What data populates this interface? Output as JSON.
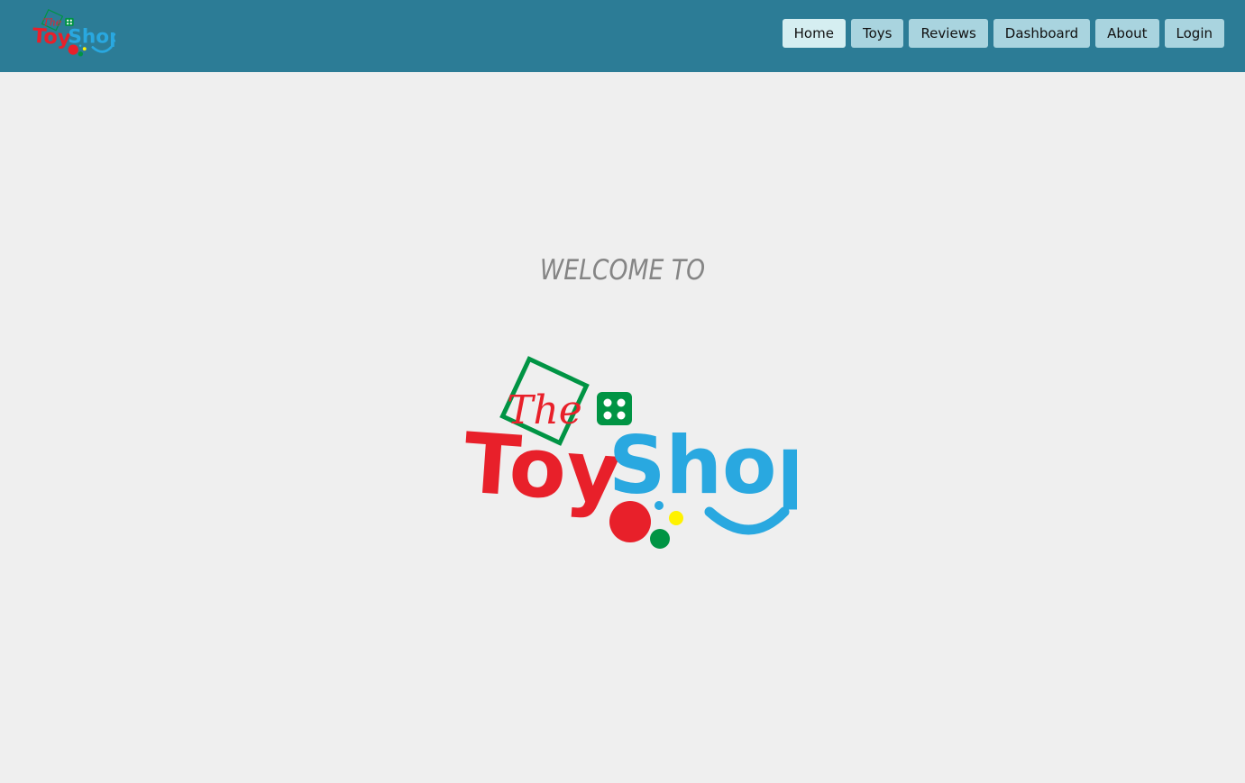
{
  "navbar": {
    "logo": {
      "icon": "toy-shop-logo-icon",
      "text_the": "The",
      "text_toy": "Toy",
      "text_shop": "Shop"
    },
    "buttons": [
      {
        "label": "Home",
        "active": true
      },
      {
        "label": "Toys",
        "active": false
      },
      {
        "label": "Reviews",
        "active": false
      },
      {
        "label": "Dashboard",
        "active": false
      },
      {
        "label": "About",
        "active": false
      },
      {
        "label": "Login",
        "active": false
      }
    ]
  },
  "main": {
    "welcome_text": "WELCOME TO",
    "logo": {
      "icon": "the-toy-shop-logo-icon",
      "text_the": "The",
      "text_toy": "Toy",
      "text_shop": "Shop"
    }
  },
  "colors": {
    "navbar_bg": "#2c7c96",
    "page_bg": "#efefef",
    "button_bg": "#a9d4df",
    "button_active_bg": "#d5eef1",
    "logo_red": "#e8202a",
    "logo_blue": "#29a8e0",
    "logo_green": "#009444",
    "logo_yellow": "#fff200",
    "welcome_text": "#858585"
  }
}
